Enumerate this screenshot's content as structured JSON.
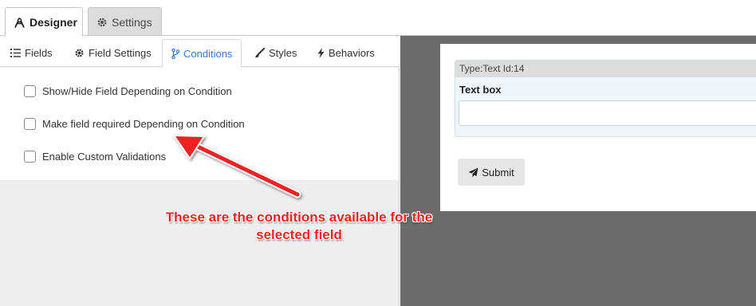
{
  "top_tabs": {
    "designer": "Designer",
    "settings": "Settings"
  },
  "sub_tabs": {
    "fields": "Fields",
    "field_settings": "Field Settings",
    "conditions": "Conditions",
    "styles": "Styles",
    "behaviors": "Behaviors"
  },
  "conditions": [
    {
      "label": "Show/Hide Field Depending on Condition",
      "checked": false
    },
    {
      "label": "Make field required Depending on Condition",
      "checked": false
    },
    {
      "label": "Enable Custom Validations",
      "checked": false
    }
  ],
  "form_preview": {
    "field_header": "Type:Text Id:14",
    "field_label": "Text box",
    "field_value": "",
    "submit_label": "Submit"
  },
  "annotation": {
    "line1": "These are the conditions available for the",
    "line2": "selected field",
    "color": "#ee2222"
  },
  "colors": {
    "accent": "#3a7bd5",
    "canvas_bg": "#6b6b6b",
    "field_bg": "#eef6fc"
  }
}
